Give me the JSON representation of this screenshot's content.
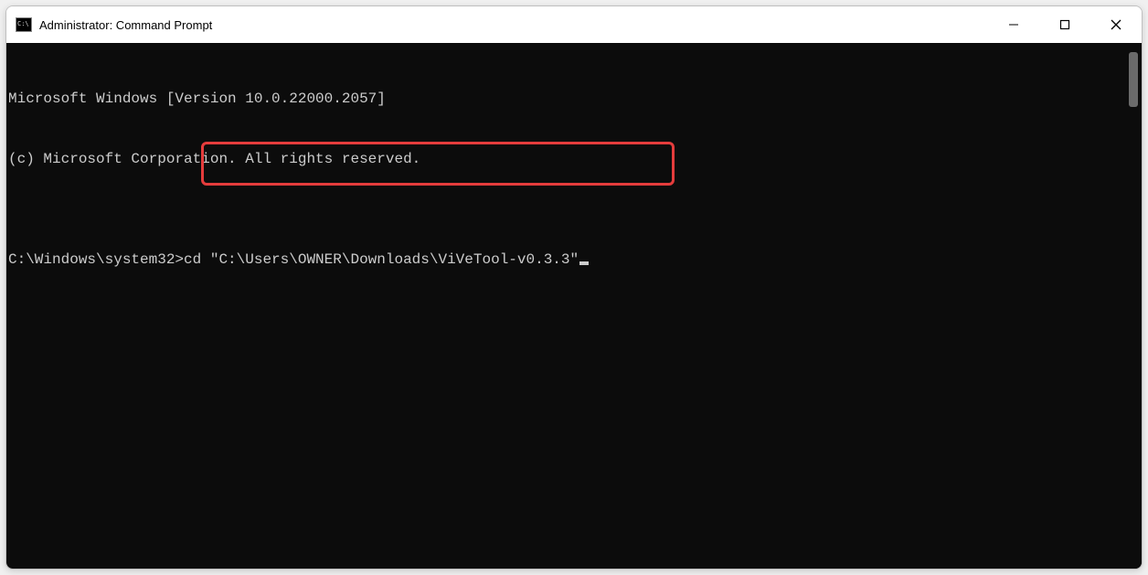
{
  "window": {
    "title": "Administrator: Command Prompt"
  },
  "terminal": {
    "line1": "Microsoft Windows [Version 10.0.22000.2057]",
    "line2": "(c) Microsoft Corporation. All rights reserved.",
    "blank": "",
    "prompt": "C:\\Windows\\system32>",
    "command": "cd \"C:\\Users\\OWNER\\Downloads\\ViVeTool-v0.3.3\""
  },
  "highlight_color": "#e53c3c"
}
